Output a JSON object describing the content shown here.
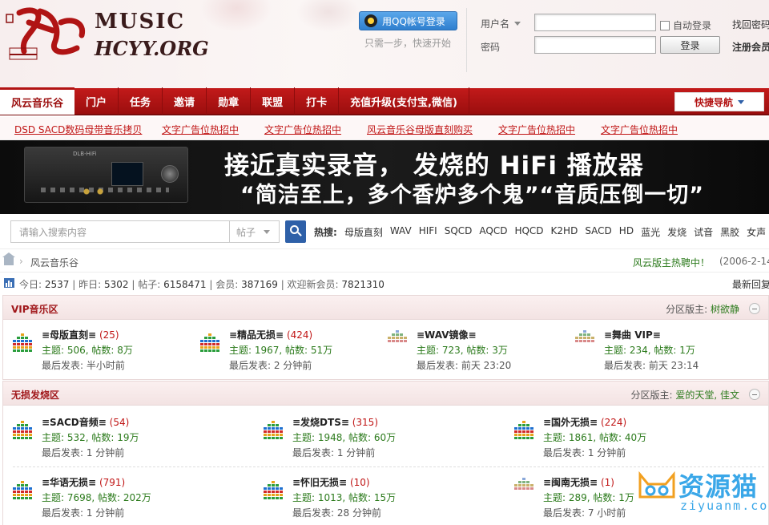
{
  "header": {
    "logo_music": "MUSIC",
    "logo_domain": "HCYY.ORG",
    "logo_chars": "风云",
    "qq_button": "用QQ帐号登录",
    "qq_sub": "只需一步，快速开始",
    "username_label": "用户名",
    "password_label": "密码",
    "auto_login": "自动登录",
    "login_button": "登录",
    "find_password": "找回密码",
    "register": "注册会员"
  },
  "nav": {
    "home": "风云音乐谷",
    "items": [
      "门户",
      "任务",
      "邀请",
      "勋章",
      "联盟",
      "打卡",
      "充值升级(支付宝,微信)"
    ],
    "quick_nav": "快捷导航"
  },
  "ad_links": [
    "DSD SACD数码母带音乐拷贝",
    "文字广告位热招中",
    "文字广告位热招中",
    "风云音乐谷母版直刻购买",
    "文字广告位热招中",
    "文字广告位热招中"
  ],
  "banner": {
    "line1": "接近真实录音，  发烧的 HiFi 播放器",
    "line2": "“简洁至上，多个香炉多个鬼”“音质压倒一切”",
    "amp_brand": "DLB-HiFi"
  },
  "search": {
    "placeholder": "请输入搜索内容",
    "type": "帖子",
    "hot_label": "热搜:",
    "hot_terms": [
      "母版直刻",
      "WAV",
      "HIFI",
      "SQCD",
      "AQCD",
      "HQCD",
      "K2HD",
      "SACD",
      "HD",
      "蓝光",
      "发烧",
      "试音",
      "黑胶",
      "女声"
    ]
  },
  "breadcrumb": {
    "name": "风云音乐谷",
    "notice": "风云版主热聘中！",
    "notice_date": "(2006-2-14)"
  },
  "stats": {
    "today_label": "今日:",
    "today": "2537",
    "yesterday_label": "昨日:",
    "yesterday": "5302",
    "posts_label": "帖子:",
    "posts": "6158471",
    "members_label": "会员:",
    "members": "387169",
    "newest_label": "欢迎新会员:",
    "newest": "7821310",
    "latest_reply": "最新回复"
  },
  "sections": [
    {
      "title": "VIP音乐区",
      "mods_label": "分区版主:",
      "mods": "树欲静",
      "forums": [
        {
          "name": "≡母版直刻≡",
          "count": "(25)",
          "stats": "主题: 506, 帖数: 8万",
          "last": "最后发表: 半小时前"
        },
        {
          "name": "≡精品无损≡",
          "count": "(424)",
          "stats": "主题: 1967, 帖数: 51万",
          "last": "最后发表: 2 分钟前"
        },
        {
          "name": "≡WAV镜像≡",
          "count": "",
          "stats": "主题: 723, 帖数: 3万",
          "last": "最后发表: 前天 23:20"
        },
        {
          "name": "≡舞曲 VIP≡",
          "count": "",
          "stats": "主题: 234, 帖数: 1万",
          "last": "最后发表: 前天 23:14"
        }
      ]
    },
    {
      "title": "无损发烧区",
      "mods_label": "分区版主:",
      "mods": "爱的天堂, 佳文",
      "forums": [
        {
          "name": "≡SACD音频≡",
          "count": "(54)",
          "stats": "主题: 532, 帖数: 19万",
          "last": "最后发表: 1 分钟前"
        },
        {
          "name": "≡发烧DTS≡",
          "count": "(315)",
          "stats": "主题: 1948, 帖数: 60万",
          "last": "最后发表: 1 分钟前"
        },
        {
          "name": "≡国外无损≡",
          "count": "(224)",
          "stats": "主题: 1861, 帖数: 40万",
          "last": "最后发表: 1 分钟前"
        },
        {
          "name": "≡华语无损≡",
          "count": "(791)",
          "stats": "主题: 7698, 帖数: 202万",
          "last": "最后发表: 1 分钟前"
        },
        {
          "name": "≡怀旧无损≡",
          "count": "(10)",
          "stats": "主题: 1013, 帖数: 15万",
          "last": "最后发表: 28 分钟前"
        },
        {
          "name": "≡闽南无损≡",
          "count": "(1)",
          "stats": "主题: 289, 帖数: 1万",
          "last": "最后发表: 7 小时前"
        }
      ]
    }
  ],
  "watermark": {
    "cn": "资源猫",
    "en": "ziyuanm.com"
  },
  "colors": {
    "nav_red": "#b21313",
    "link_red": "#c01515",
    "green": "#2b7a1b",
    "accent_blue": "#2e60a8"
  }
}
